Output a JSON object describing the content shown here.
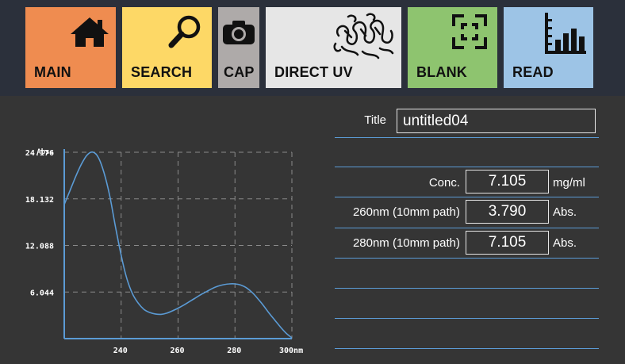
{
  "toolbar": {
    "buttons": [
      {
        "label": "MAIN",
        "icon": "home-icon",
        "color": "#ef8c50"
      },
      {
        "label": "SEARCH",
        "icon": "search-icon",
        "color": "#fdd866"
      },
      {
        "label": "CAP",
        "icon": "camera-icon",
        "color": "#aeaaa9"
      },
      {
        "label": "DIRECT UV",
        "icon": "protein-structure-icon",
        "color": "#e6e6e6"
      },
      {
        "label": "BLANK",
        "icon": "blank-frame-icon",
        "color": "#8ec46f"
      },
      {
        "label": "READ",
        "icon": "bar-chart-icon",
        "color": "#9dc4e6"
      }
    ]
  },
  "sample": {
    "title_label": "Title",
    "title_value": "untitled04"
  },
  "results": {
    "conc_label": "Conc.",
    "conc_value": "7.105",
    "conc_unit": "mg/ml",
    "a260_label": "260nm (10mm path)",
    "a260_value": "3.790",
    "a260_unit": "Abs.",
    "a280_label": "280nm (10mm path)",
    "a280_value": "7.105",
    "a280_unit": "Abs."
  },
  "chart_data": {
    "type": "line",
    "ylabel": "Abs.",
    "xlim": [
      220,
      300
    ],
    "ylim": [
      0,
      24.176
    ],
    "y_ticks": [
      "24.176",
      "18.132",
      "12.088",
      "6.044"
    ],
    "y_tick_values": [
      24.176,
      18.132,
      12.088,
      6.044
    ],
    "x_ticks": [
      "240",
      "260",
      "280",
      "300nm"
    ],
    "x_tick_values": [
      240,
      260,
      280,
      300
    ],
    "grid": true,
    "line_color": "#5b9bd5",
    "series": [
      {
        "x": [
          220,
          222,
          224,
          226,
          228,
          230,
          232,
          234,
          236,
          238,
          240,
          242,
          244,
          246,
          248,
          250,
          252,
          254,
          256,
          258,
          260,
          262,
          264,
          266,
          268,
          270,
          272,
          274,
          276,
          278,
          280,
          282,
          284,
          286,
          288,
          290,
          292,
          294,
          296,
          298,
          300
        ],
        "y": [
          17.4,
          19.2,
          21.0,
          22.6,
          23.8,
          24.2,
          23.5,
          21.5,
          18.5,
          14.5,
          10.8,
          7.8,
          5.8,
          4.6,
          3.8,
          3.4,
          3.2,
          3.15,
          3.3,
          3.6,
          3.95,
          4.35,
          4.8,
          5.25,
          5.7,
          6.1,
          6.5,
          6.8,
          7.0,
          7.1,
          7.1,
          6.95,
          6.6,
          6.0,
          5.2,
          4.3,
          3.3,
          2.4,
          1.5,
          0.7,
          0.1
        ]
      }
    ]
  }
}
